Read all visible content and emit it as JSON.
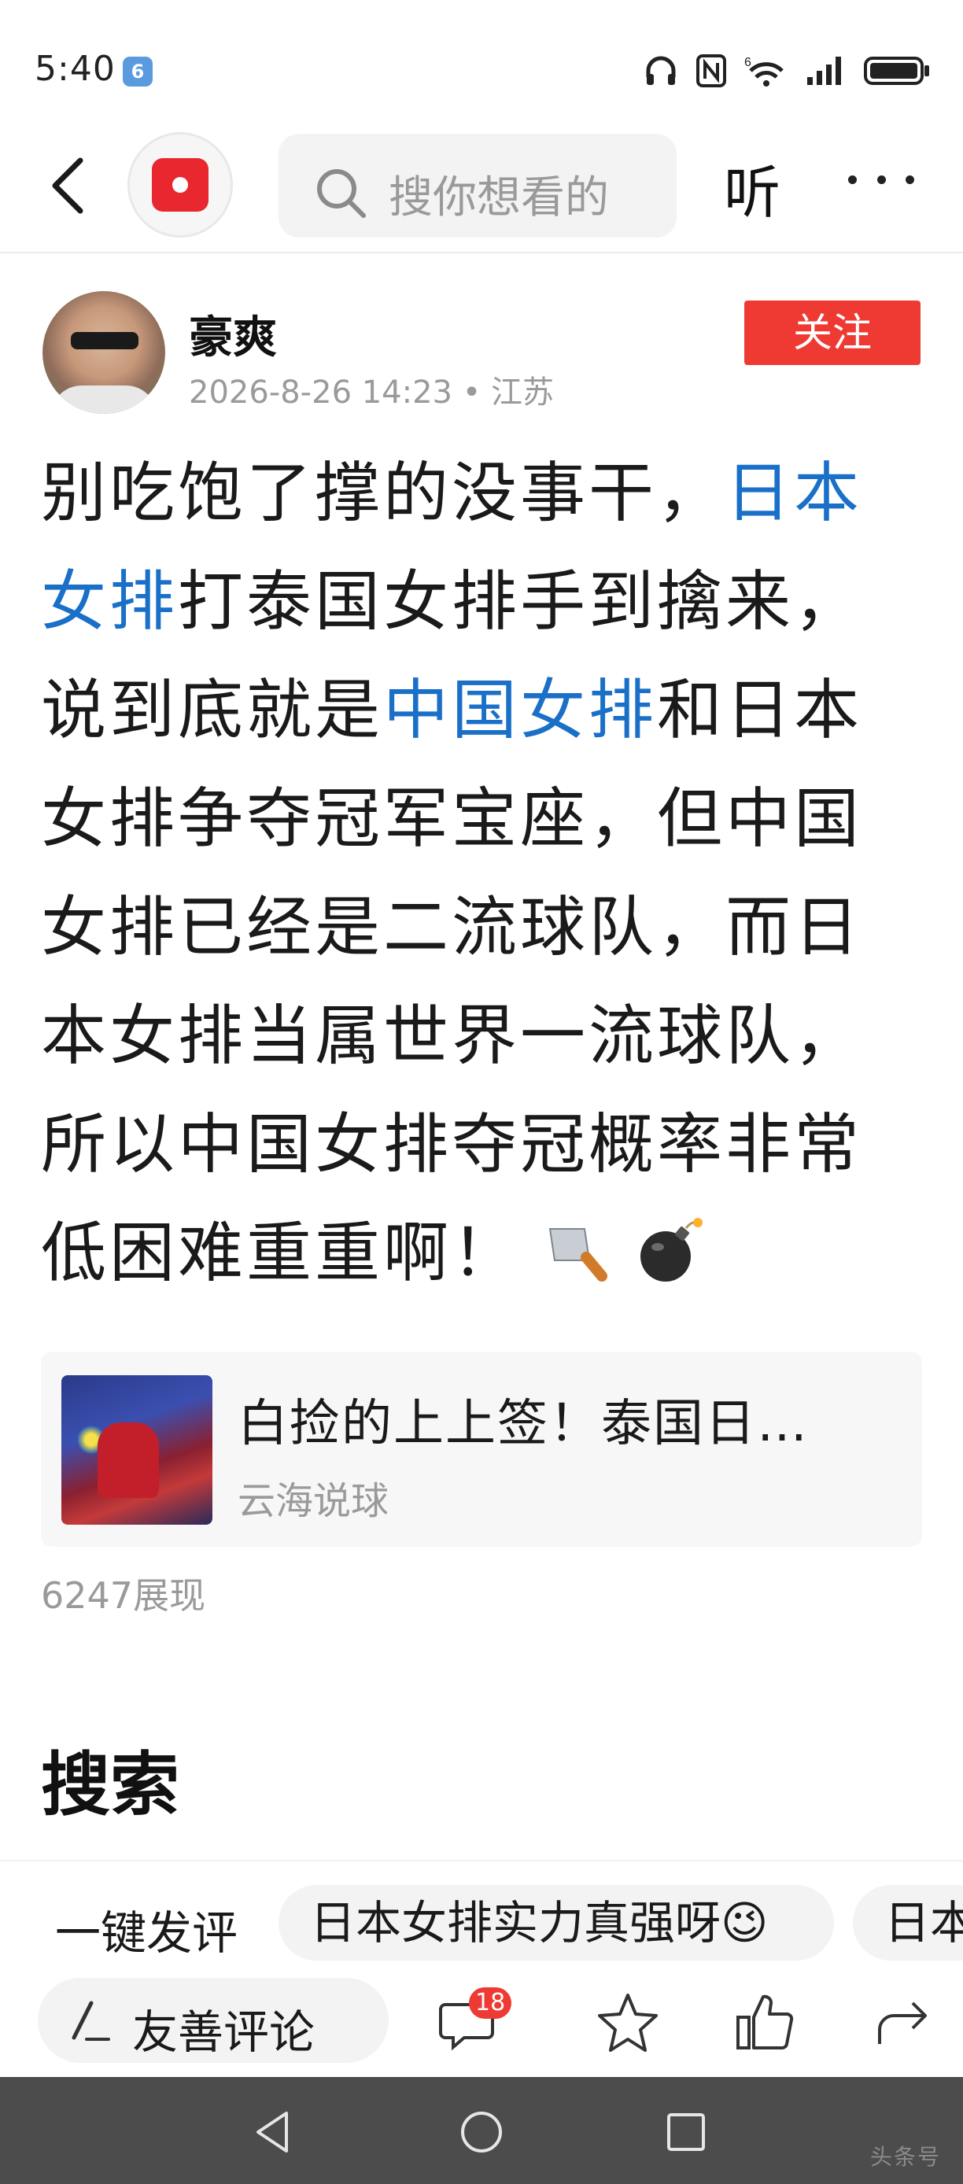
{
  "status_bar": {
    "time": "5:40",
    "badge": "6"
  },
  "nav": {
    "search_placeholder": "搜你想看的",
    "listen_label": "听"
  },
  "post": {
    "author": "豪爽",
    "meta": "2026-8-26 14:23 • 江苏",
    "follow_label": "关注",
    "body_segments": [
      {
        "text": "别吃饱了撑的没事干，",
        "link": false
      },
      {
        "text": "日本女排",
        "link": true
      },
      {
        "text": "打泰国女排手到擒来，说到底就是",
        "link": false
      },
      {
        "text": "中国女排",
        "link": true
      },
      {
        "text": "和日本女排争夺冠军宝座，但中国女排已经是二流球队，而日本女排当属世界一流球队，所以中国女排夺冠概率非常低困难重重啊！",
        "link": false
      }
    ],
    "emojis": [
      "kitchen-knife",
      "bomb"
    ],
    "linked_card": {
      "title": "白捡的上上签！泰国日…",
      "source": "云海说球"
    },
    "views": "6247展现"
  },
  "search_section": {
    "heading": "搜索"
  },
  "bottom": {
    "quick_comment_label": "一键发评",
    "chips": [
      "日本女排实力真强呀😉",
      "日本"
    ],
    "comment_placeholder": "友善评论",
    "comment_count": "18"
  },
  "watermark": "头条号"
}
